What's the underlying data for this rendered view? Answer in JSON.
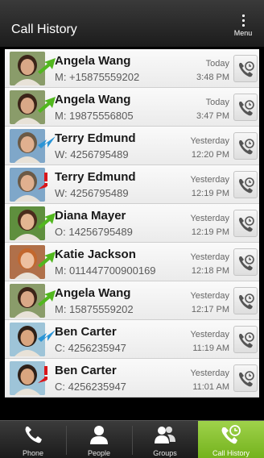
{
  "header": {
    "title": "Call History",
    "menu_label": "Menu"
  },
  "calls": [
    {
      "name": "Angela Wang",
      "number": "M: +15875559202",
      "day": "Today",
      "time": "3:48 PM",
      "direction": "outgoing"
    },
    {
      "name": "Angela Wang",
      "number": "M: 19875556805",
      "day": "Today",
      "time": "3:47 PM",
      "direction": "outgoing"
    },
    {
      "name": "Terry Edmund",
      "number": "W: 4256795489",
      "day": "Yesterday",
      "time": "12:20 PM",
      "direction": "incoming"
    },
    {
      "name": "Terry Edmund",
      "number": "W: 4256795489",
      "day": "Yesterday",
      "time": "12:19 PM",
      "direction": "missed"
    },
    {
      "name": "Diana Mayer",
      "number": "O: 14256795489",
      "day": "Yesterday",
      "time": "12:19 PM",
      "direction": "outgoing"
    },
    {
      "name": "Katie Jackson",
      "number": "M: 011447700900169",
      "day": "Yesterday",
      "time": "12:18 PM",
      "direction": "outgoing"
    },
    {
      "name": "Angela Wang",
      "number": "M: 15875559202",
      "day": "Yesterday",
      "time": "12:17 PM",
      "direction": "outgoing"
    },
    {
      "name": "Ben Carter",
      "number": "C: 4256235947",
      "day": "Yesterday",
      "time": "11:19 AM",
      "direction": "incoming"
    },
    {
      "name": "Ben Carter",
      "number": "C: 4256235947",
      "day": "Yesterday",
      "time": "11:01 AM",
      "direction": "missed"
    }
  ],
  "bottom_nav": [
    {
      "label": "Phone",
      "icon": "phone-icon"
    },
    {
      "label": "People",
      "icon": "person-icon"
    },
    {
      "label": "Groups",
      "icon": "group-icon"
    },
    {
      "label": "Call History",
      "icon": "call-history-icon"
    }
  ],
  "colors": {
    "outgoing": "#52b71f",
    "incoming": "#2a94d6",
    "missed": "#d9161b",
    "active_tab": "#86c230",
    "header_bg": "#2a2a2a"
  }
}
